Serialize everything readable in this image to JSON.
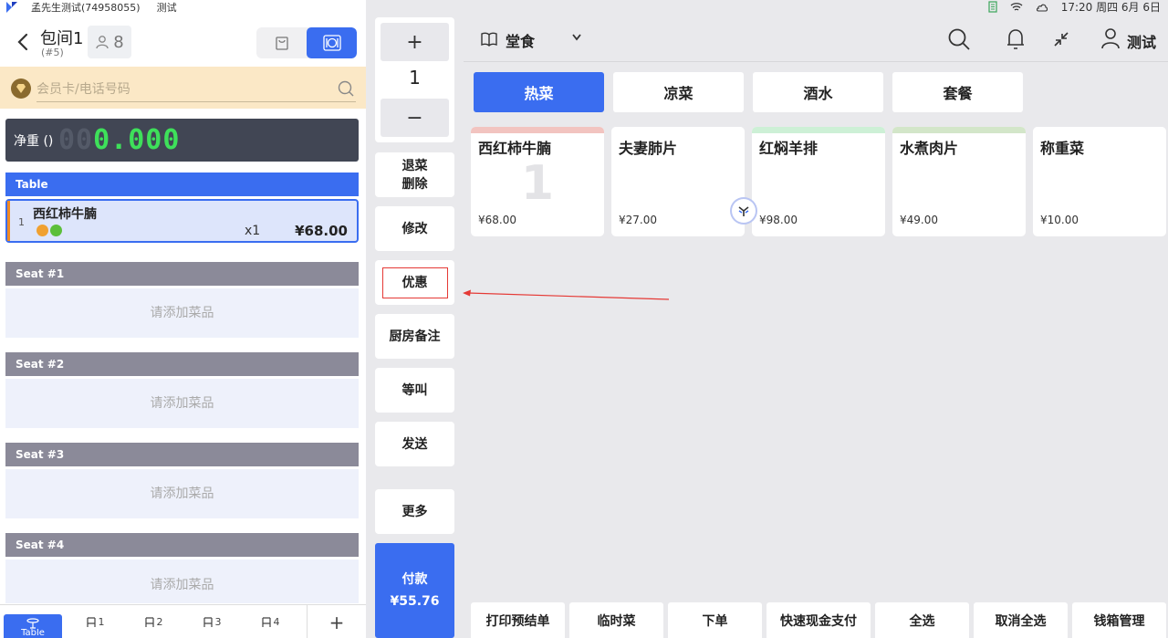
{
  "status_left": {
    "account": "孟先生测试(74958055)",
    "store": "测试"
  },
  "status_right": {
    "time": "17:20 周四 6月 6日"
  },
  "order_header": {
    "room": "包间1",
    "code": "(#5)",
    "guests": "8"
  },
  "member": {
    "placeholder": "会员卡/电话号码"
  },
  "scale": {
    "label": "净重 ()",
    "dim_digits": "00",
    "value": "0.000"
  },
  "groups": {
    "table": "Table",
    "seats": [
      "Seat #1",
      "Seat #2",
      "Seat #3",
      "Seat #4"
    ],
    "empty_hint": "请添加菜品"
  },
  "order_item": {
    "index": "1",
    "name": "西红柿牛腩",
    "qty": "x1",
    "price": "¥68.00"
  },
  "bottom_tabs": {
    "table": "Table",
    "seats": [
      "1",
      "2",
      "3",
      "4"
    ],
    "add": "+"
  },
  "stepper": {
    "plus": "+",
    "value": "1",
    "minus": "−"
  },
  "actions": {
    "void_line1": "退菜",
    "void_line2": "删除",
    "modify": "修改",
    "discount": "优惠",
    "kitchen_note": "厨房备注",
    "hold": "等叫",
    "send": "发送",
    "more": "更多",
    "pay": "付款",
    "pay_amount": "¥55.76"
  },
  "topbar": {
    "dine_mode": "堂食",
    "user": "测试"
  },
  "categories": [
    "热菜",
    "凉菜",
    "酒水",
    "套餐"
  ],
  "dishes": [
    {
      "name": "西红柿牛腩",
      "price": "¥68.00",
      "count": "1",
      "strip": "#f2c4c0"
    },
    {
      "name": "夫妻肺片",
      "price": "¥27.00",
      "count": "",
      "strip": "#ffffff"
    },
    {
      "name": "红焖羊排",
      "price": "¥98.00",
      "count": "",
      "strip": "#cdf0d6"
    },
    {
      "name": "水煮肉片",
      "price": "¥49.00",
      "count": "",
      "strip": "#d3e6c9"
    },
    {
      "name": "称重菜",
      "price": "¥10.00",
      "count": "",
      "strip": "#ffffff"
    }
  ],
  "bottom_actions": [
    "打印预结单",
    "临时菜",
    "下单",
    "快速现金支付",
    "全选",
    "取消全选",
    "钱箱管理"
  ],
  "colors": {
    "accent": "#3a6df0",
    "scale_digits": "#3ee05a",
    "highlight": "#e53935"
  }
}
